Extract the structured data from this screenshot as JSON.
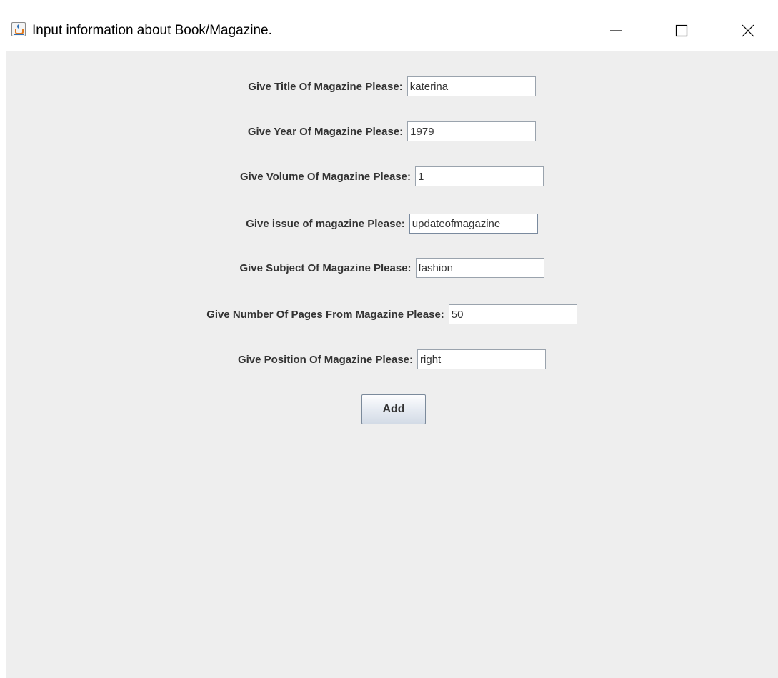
{
  "window": {
    "title": "Input information about Book/Magazine.",
    "icon": "java-cup-icon"
  },
  "controls": {
    "minimize_icon": "minimize-icon",
    "maximize_icon": "maximize-icon",
    "close_icon": "close-icon"
  },
  "form": {
    "fields": [
      {
        "label": "Give Title Of Magazine Please:",
        "value": "katerina"
      },
      {
        "label": "Give Year Of Magazine Please:",
        "value": "1979"
      },
      {
        "label": "Give Volume Of Magazine Please:",
        "value": "1"
      },
      {
        "label": "Give issue of magazine Please:",
        "value": "updateofmagazine"
      },
      {
        "label": "Give Subject Of Magazine Please:",
        "value": "fashion"
      },
      {
        "label": "Give Number Of Pages From Magazine Please:",
        "value": "50"
      },
      {
        "label": "Give Position Of Magazine Please:",
        "value": "right"
      }
    ],
    "add_label": "Add"
  },
  "colors": {
    "panel_background": "#eeeeee",
    "label_text": "#333333"
  }
}
